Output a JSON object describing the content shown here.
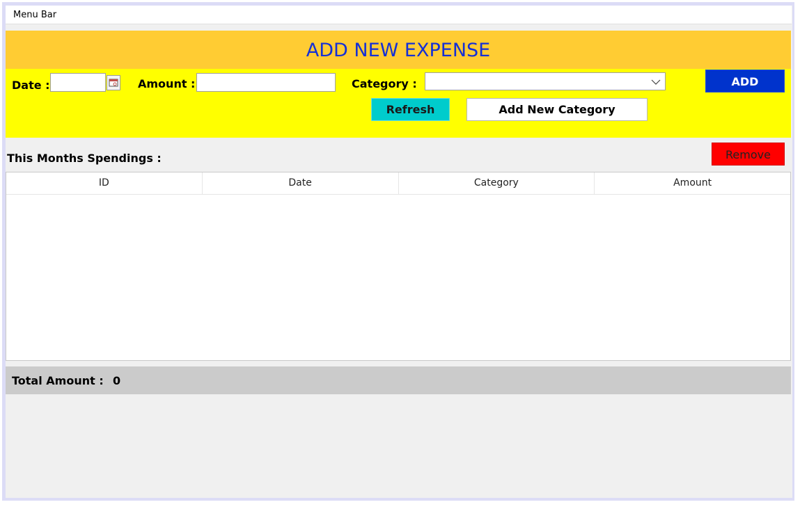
{
  "menu_bar": {
    "label": "Menu Bar"
  },
  "header": {
    "title": "ADD NEW EXPENSE"
  },
  "form": {
    "date_label": "Date :",
    "date_value": "",
    "amount_label": "Amount :",
    "amount_value": "",
    "category_label": "Category :",
    "category_selected": "",
    "add_label": "ADD",
    "refresh_label": "Refresh",
    "add_category_label": "Add New Category"
  },
  "spendings": {
    "heading": "This Months Spendings :",
    "remove_label": "Remove",
    "columns": [
      "ID",
      "Date",
      "Category",
      "Amount"
    ],
    "rows": []
  },
  "total": {
    "label": "Total Amount :",
    "value": "0"
  },
  "colors": {
    "title_bg": "#ffcc33",
    "title_text": "#1530d6",
    "form_bg": "#ffff00",
    "add_button": "#0033cc",
    "refresh_button": "#00cccc",
    "remove_button": "#ff0000",
    "total_bar": "#cbcbcb"
  }
}
